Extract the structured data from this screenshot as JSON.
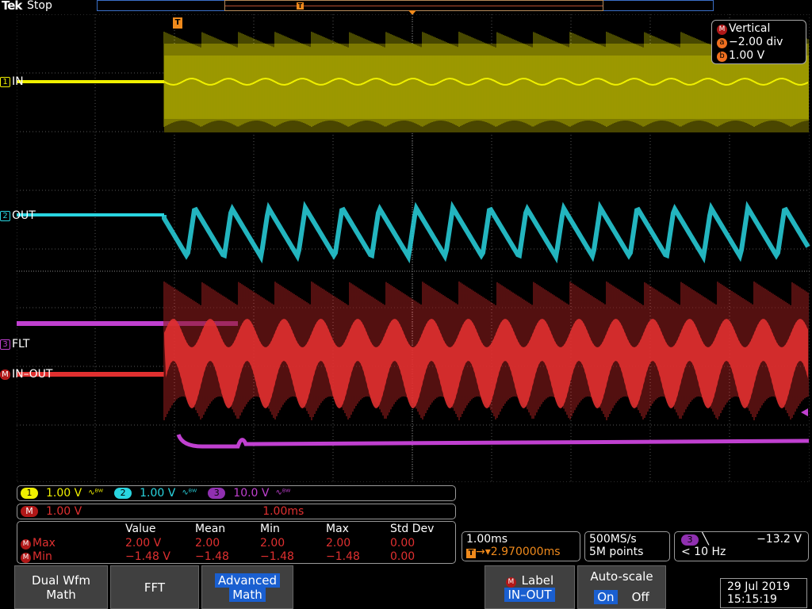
{
  "header": {
    "brand": "Tek",
    "run_state": "Stop",
    "trigger_marker_label": "T"
  },
  "channels": {
    "ch1": {
      "number": "1",
      "label": "IN",
      "scale": "1.00 V",
      "color": "#f0f000"
    },
    "ch2": {
      "number": "2",
      "label": "OUT",
      "scale": "1.00 V",
      "color": "#29d5e0"
    },
    "ch3": {
      "number": "3",
      "label": "FLT",
      "scale": "10.0 V",
      "color": "#c040d0"
    },
    "math": {
      "label_letter": "M",
      "label": "IN–OUT",
      "scale": "1.00 V",
      "time_scale": "1.00ms",
      "color": "#e03030"
    }
  },
  "vertical_panel": {
    "title": "Vertical",
    "a_letter": "a",
    "a_value": "−2.00 div",
    "b_letter": "b",
    "b_value": "1.00 V"
  },
  "measurements": {
    "headers": [
      "Value",
      "Mean",
      "Min",
      "Max",
      "Std Dev"
    ],
    "rows": [
      {
        "badge": "M",
        "name": "Max",
        "values": [
          "2.00 V",
          "2.00",
          "2.00",
          "2.00",
          "0.00"
        ]
      },
      {
        "badge": "M",
        "name": "Min",
        "values": [
          "−1.48 V",
          "−1.48",
          "−1.48",
          "−1.48",
          "0.00"
        ]
      }
    ]
  },
  "horizontal": {
    "scale": "1.00ms",
    "trigger_delay": "2.970000ms",
    "trigger_letter": "T"
  },
  "acquisition": {
    "sample_rate": "500MS/s",
    "record_length": "5M points"
  },
  "trigger": {
    "source": "3",
    "slope": "╲",
    "level": "−13.2 V",
    "frequency": "< 10 Hz"
  },
  "softkeys": {
    "dual_wfm_line1": "Dual Wfm",
    "dual_wfm_line2": "Math",
    "fft": "FFT",
    "advanced_line1": "Advanced",
    "advanced_line2": "Math",
    "label_title": "Label",
    "label_value": "IN–OUT",
    "autoscale_title": "Auto-scale",
    "autoscale_on": "On",
    "autoscale_off": "Off"
  },
  "datetime": {
    "date": "29 Jul  2019",
    "time": "15:15:19"
  }
}
